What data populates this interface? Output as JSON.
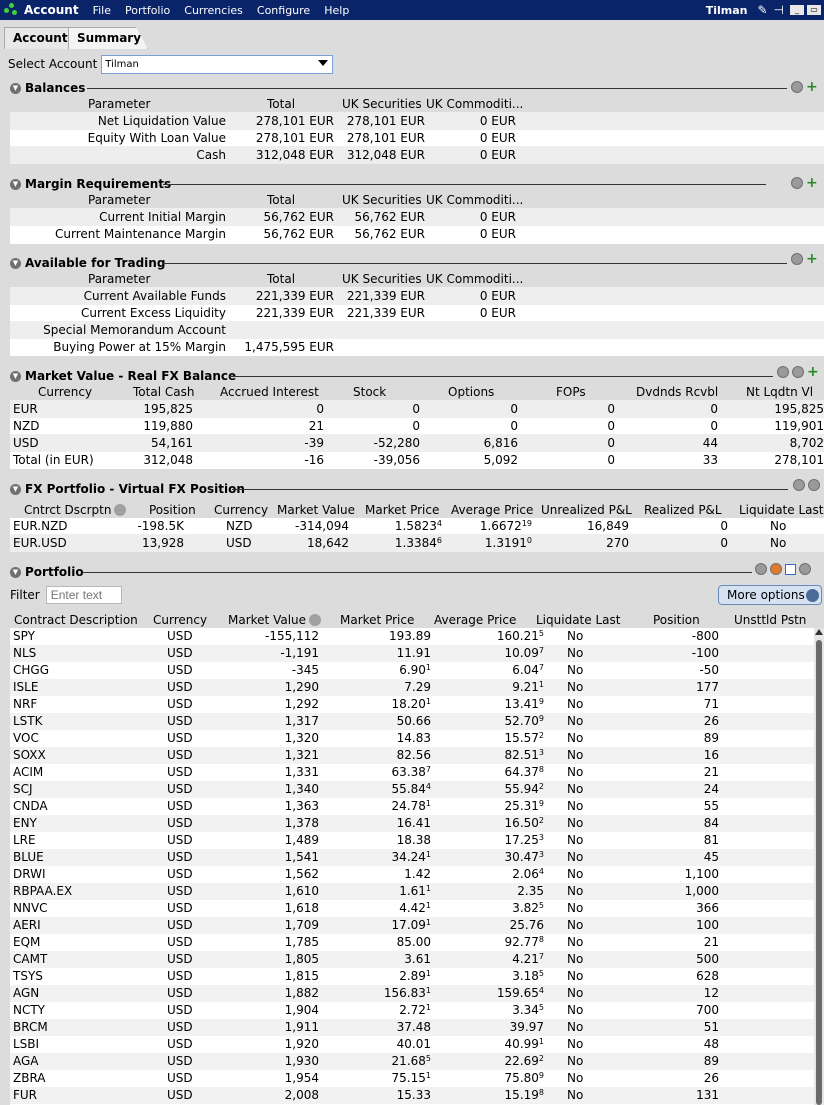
{
  "titlebar": {
    "app": "Account",
    "menus": [
      "File",
      "Portfolio",
      "Currencies",
      "Configure",
      "Help"
    ],
    "user": "Tilman"
  },
  "tabs": [
    "Account",
    "Summary"
  ],
  "select_account": {
    "label": "Select Account",
    "value": "Tilman"
  },
  "balances": {
    "title": "Balances",
    "headers": [
      "Parameter",
      "Total",
      "UK Securities",
      "UK Commoditi..."
    ],
    "rows": [
      [
        "Net Liquidation Value",
        "278,101 EUR",
        "278,101 EUR",
        "0 EUR"
      ],
      [
        "Equity With Loan Value",
        "278,101 EUR",
        "278,101 EUR",
        "0 EUR"
      ],
      [
        "Cash",
        "312,048 EUR",
        "312,048 EUR",
        "0 EUR"
      ]
    ]
  },
  "margin": {
    "title": "Margin Requirements",
    "headers": [
      "Parameter",
      "Total",
      "UK Securities",
      "UK Commoditi..."
    ],
    "rows": [
      [
        "Current Initial Margin",
        "56,762 EUR",
        "56,762 EUR",
        "0 EUR"
      ],
      [
        "Current Maintenance Margin",
        "56,762 EUR",
        "56,762 EUR",
        "0 EUR"
      ]
    ]
  },
  "trading": {
    "title": "Available for Trading",
    "headers": [
      "Parameter",
      "Total",
      "UK Securities",
      "UK Commoditi..."
    ],
    "rows": [
      [
        "Current Available Funds",
        "221,339 EUR",
        "221,339 EUR",
        "0 EUR"
      ],
      [
        "Current Excess Liquidity",
        "221,339 EUR",
        "221,339 EUR",
        "0 EUR"
      ],
      [
        "Special Memorandum Account",
        "",
        "",
        ""
      ],
      [
        "Buying Power at 15% Margin",
        "1,475,595 EUR",
        "",
        ""
      ]
    ]
  },
  "market_value": {
    "title": "Market Value - Real FX Balance",
    "headers": [
      "Currency",
      "Total Cash",
      "Accrued Interest",
      "Stock",
      "Options",
      "FOPs",
      "Dvdnds Rcvbl",
      "Nt Lqdtn Vl"
    ],
    "rows": [
      [
        "EUR",
        "195,825",
        "0",
        "0",
        "0",
        "0",
        "0",
        "195,825"
      ],
      [
        "NZD",
        "119,880",
        "21",
        "0",
        "0",
        "0",
        "0",
        "119,901"
      ],
      [
        "USD",
        "54,161",
        "-39",
        "-52,280",
        "6,816",
        "0",
        "44",
        "8,702"
      ],
      [
        "Total (in EUR)",
        "312,048",
        "-16",
        "-39,056",
        "5,092",
        "0",
        "33",
        "278,101"
      ]
    ]
  },
  "fx_portfolio": {
    "title": "FX Portfolio - Virtual FX Position",
    "headers": [
      "Cntrct Dscrptn",
      "Position",
      "Currency",
      "Market Value",
      "Market Price",
      "Average Price",
      "Unrealized P&L",
      "Realized P&L",
      "Liquidate Last"
    ],
    "rows": [
      {
        "desc": "EUR.NZD",
        "pos": "-198.5K",
        "cur": "NZD",
        "mv": "-314,094",
        "mp": "1.5823",
        "mp_s": "4",
        "ap": "1.6672",
        "ap_s": "19",
        "upl": "16,849",
        "rpl": "0",
        "liq": "No"
      },
      {
        "desc": "EUR.USD",
        "pos": "13,928",
        "cur": "USD",
        "mv": "18,642",
        "mp": "1.3384",
        "mp_s": "6",
        "ap": "1.3191",
        "ap_s": "0",
        "upl": "270",
        "rpl": "0",
        "liq": "No"
      }
    ]
  },
  "portfolio": {
    "title": "Portfolio",
    "filter_label": "Filter",
    "filter_placeholder": "Enter text",
    "more_options": "More options",
    "headers": [
      "Contract Description",
      "Currency",
      "Market Value",
      "Market Price",
      "Average Price",
      "Liquidate Last",
      "Position",
      "Unsttld Pstn"
    ],
    "rows": [
      [
        "SPY",
        "USD",
        "-155,112",
        "193.89",
        "",
        "160.21",
        "5",
        "No",
        "-800"
      ],
      [
        "NLS",
        "USD",
        "-1,191",
        "11.91",
        "",
        "10.09",
        "7",
        "No",
        "-100"
      ],
      [
        "CHGG",
        "USD",
        "-345",
        "6.90",
        "1",
        "6.04",
        "7",
        "No",
        "-50"
      ],
      [
        "ISLE",
        "USD",
        "1,290",
        "7.29",
        "",
        "9.21",
        "1",
        "No",
        "177"
      ],
      [
        "NRF",
        "USD",
        "1,292",
        "18.20",
        "1",
        "13.41",
        "9",
        "No",
        "71"
      ],
      [
        "LSTK",
        "USD",
        "1,317",
        "50.66",
        "",
        "52.70",
        "9",
        "No",
        "26"
      ],
      [
        "VOC",
        "USD",
        "1,320",
        "14.83",
        "",
        "15.57",
        "2",
        "No",
        "89"
      ],
      [
        "SOXX",
        "USD",
        "1,321",
        "82.56",
        "",
        "82.51",
        "3",
        "No",
        "16"
      ],
      [
        "ACIM",
        "USD",
        "1,331",
        "63.38",
        "7",
        "64.37",
        "8",
        "No",
        "21"
      ],
      [
        "SCJ",
        "USD",
        "1,340",
        "55.84",
        "4",
        "55.94",
        "2",
        "No",
        "24"
      ],
      [
        "CNDA",
        "USD",
        "1,363",
        "24.78",
        "1",
        "25.31",
        "9",
        "No",
        "55"
      ],
      [
        "ENY",
        "USD",
        "1,378",
        "16.41",
        "",
        "16.50",
        "2",
        "No",
        "84"
      ],
      [
        "LRE",
        "USD",
        "1,489",
        "18.38",
        "",
        "17.25",
        "3",
        "No",
        "81"
      ],
      [
        "BLUE",
        "USD",
        "1,541",
        "34.24",
        "1",
        "30.47",
        "3",
        "No",
        "45"
      ],
      [
        "DRWI",
        "USD",
        "1,562",
        "1.42",
        "",
        "2.06",
        "4",
        "No",
        "1,100"
      ],
      [
        "RBPAA.EX",
        "USD",
        "1,610",
        "1.61",
        "1",
        "2.35",
        "",
        "No",
        "1,000"
      ],
      [
        "NNVC",
        "USD",
        "1,618",
        "4.42",
        "1",
        "3.82",
        "5",
        "No",
        "366"
      ],
      [
        "AERI",
        "USD",
        "1,709",
        "17.09",
        "1",
        "25.76",
        "",
        "No",
        "100"
      ],
      [
        "EQM",
        "USD",
        "1,785",
        "85.00",
        "",
        "92.77",
        "8",
        "No",
        "21"
      ],
      [
        "CAMT",
        "USD",
        "1,805",
        "3.61",
        "",
        "4.21",
        "7",
        "No",
        "500"
      ],
      [
        "TSYS",
        "USD",
        "1,815",
        "2.89",
        "1",
        "3.18",
        "5",
        "No",
        "628"
      ],
      [
        "AGN",
        "USD",
        "1,882",
        "156.83",
        "1",
        "159.65",
        "4",
        "No",
        "12"
      ],
      [
        "NCTY",
        "USD",
        "1,904",
        "2.72",
        "1",
        "3.34",
        "5",
        "No",
        "700"
      ],
      [
        "BRCM",
        "USD",
        "1,911",
        "37.48",
        "",
        "39.97",
        "",
        "No",
        "51"
      ],
      [
        "LSBI",
        "USD",
        "1,920",
        "40.01",
        "",
        "40.99",
        "1",
        "No",
        "48"
      ],
      [
        "AGA",
        "USD",
        "1,930",
        "21.68",
        "5",
        "22.69",
        "2",
        "No",
        "89"
      ],
      [
        "ZBRA",
        "USD",
        "1,954",
        "75.15",
        "1",
        "75.80",
        "9",
        "No",
        "26"
      ],
      [
        "FUR",
        "USD",
        "2,008",
        "15.33",
        "",
        "15.19",
        "8",
        "No",
        "131"
      ]
    ]
  }
}
